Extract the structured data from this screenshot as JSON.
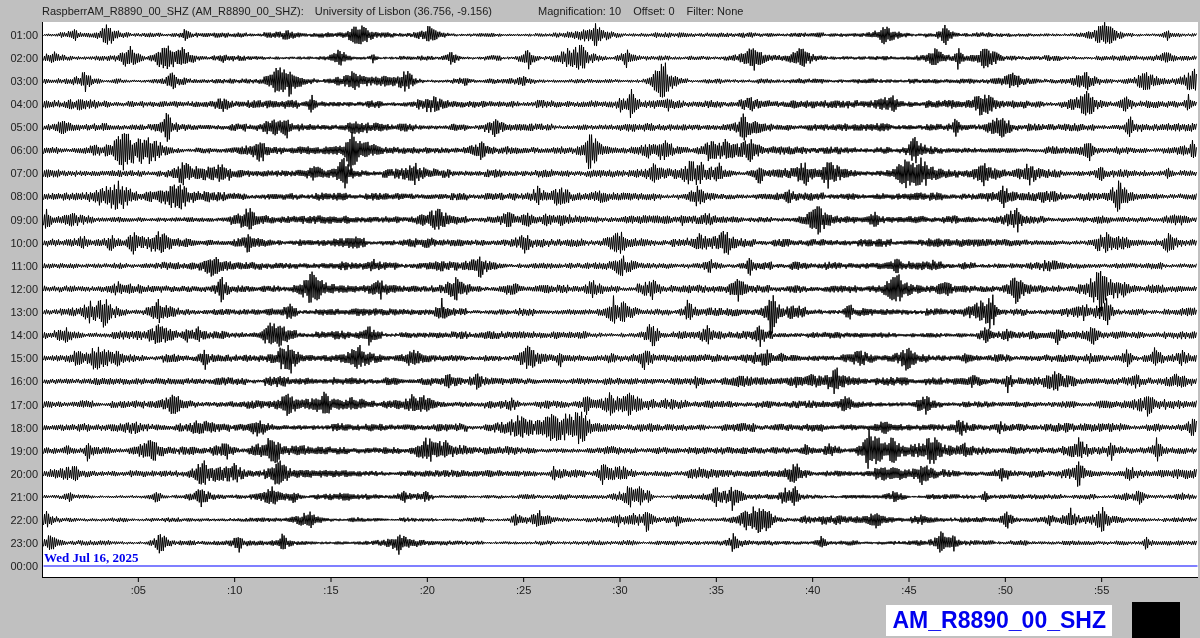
{
  "header": {
    "station": "RaspberrAM_R8890_00_SHZ (AM_R8890_00_SHZ):",
    "location": "University of Lisbon (36.756, -9.156)",
    "magnification": "Magnification: 10",
    "offset": "Offset: 0",
    "filter": "Filter: None"
  },
  "rows": [
    {
      "time": "01:00",
      "kind": "trace"
    },
    {
      "time": "02:00",
      "kind": "trace"
    },
    {
      "time": "03:00",
      "kind": "trace"
    },
    {
      "time": "04:00",
      "kind": "trace"
    },
    {
      "time": "05:00",
      "kind": "trace"
    },
    {
      "time": "06:00",
      "kind": "trace"
    },
    {
      "time": "07:00",
      "kind": "trace"
    },
    {
      "time": "08:00",
      "kind": "trace"
    },
    {
      "time": "09:00",
      "kind": "trace"
    },
    {
      "time": "10:00",
      "kind": "trace"
    },
    {
      "time": "11:00",
      "kind": "trace"
    },
    {
      "time": "12:00",
      "kind": "trace"
    },
    {
      "time": "13:00",
      "kind": "trace"
    },
    {
      "time": "14:00",
      "kind": "trace"
    },
    {
      "time": "15:00",
      "kind": "trace"
    },
    {
      "time": "16:00",
      "kind": "trace"
    },
    {
      "time": "17:00",
      "kind": "trace"
    },
    {
      "time": "18:00",
      "kind": "trace"
    },
    {
      "time": "19:00",
      "kind": "trace"
    },
    {
      "time": "20:00",
      "kind": "trace"
    },
    {
      "time": "21:00",
      "kind": "trace"
    },
    {
      "time": "22:00",
      "kind": "trace"
    },
    {
      "time": "23:00",
      "kind": "trace"
    },
    {
      "time": "00:00",
      "kind": "current"
    }
  ],
  "date_label": "Wed Jul 16, 2025",
  "minute_ticks": [
    ":05",
    ":10",
    ":15",
    ":20",
    ":25",
    ":30",
    ":35",
    ":40",
    ":45",
    ":50",
    ":55"
  ],
  "station_label": "AM_R8890_00_SHZ"
}
